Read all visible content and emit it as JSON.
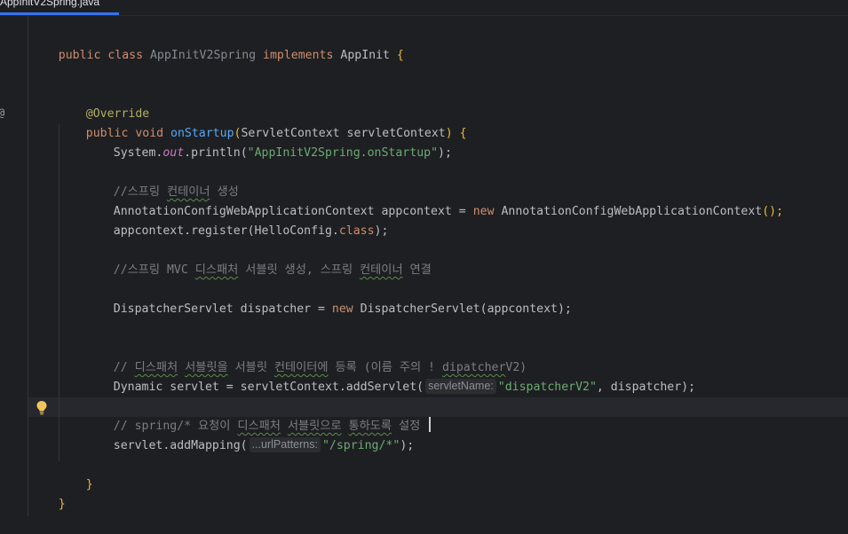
{
  "tab": {
    "label": "AppInitV2Spring.java"
  },
  "code": {
    "l1": {
      "kw1": "public ",
      "kw2": "class ",
      "name": "AppInitV2Spring ",
      "kw3": "implements ",
      "iface": "AppInit ",
      "brace": "{"
    },
    "l2": {
      "ann": "@Override"
    },
    "l3": {
      "kw1": "public ",
      "kw2": "void ",
      "fn": "onStartup",
      "p1": "(",
      "type": "ServletContext servletContext",
      "p2": ") ",
      "brace": "{"
    },
    "l4": {
      "a": "System.",
      "out": "out",
      "b": ".println(",
      "str": "\"AppInitV2Spring.onStartup\"",
      "c": ");"
    },
    "l5": {
      "cmt1": "//스프링 ",
      "typo": "컨테이너",
      "cmt2": " 생성"
    },
    "l6": {
      "a": "AnnotationConfigWebApplicationContext appcontext = ",
      "kw": "new ",
      "b": "AnnotationConfigWebApplicationContext",
      "c": "();"
    },
    "l7": {
      "a": "appcontext.register(HelloConfig.",
      "kw": "class",
      "b": ");"
    },
    "l8": {
      "cmt1": "//스프링 MVC ",
      "typo1": "디스패처",
      "cmt2": " 서블릿 생성, 스프링 ",
      "typo2": "컨테이너",
      "cmt3": " 연결"
    },
    "l9": {
      "a": "DispatcherServlet dispatcher = ",
      "kw": "new ",
      "b": "DispatcherServlet(appcontext);"
    },
    "l10": {
      "cmt1": "// ",
      "typo1": "디스패처",
      "cmt2": " ",
      "typo2": "서블릿을",
      "cmt3": " 서블릿 ",
      "typo3": "컨테이터에",
      "cmt4": " 등록 (이름 주의 ! ",
      "typo4": "dipatcher",
      "cmt5": "V2)"
    },
    "l11": {
      "a": "Dynamic servlet = servletContext.addServlet(",
      "hint": "servletName:",
      "str": "\"dispatcherV2\"",
      "b": ", dispatcher);"
    },
    "l12": {
      "cmt1": "// spring/* 요청이 ",
      "typo1": "디스패처",
      "cmt2": " ",
      "typo2": "서블릿으로",
      "cmt3": " ",
      "typo3": "통하도록",
      "cmt4": " 설정 "
    },
    "l13": {
      "a": "servlet.addMapping(",
      "hint": "...urlPatterns:",
      "str": "\"/spring/*\"",
      "b": ");"
    },
    "l14": {
      "brace": "}"
    },
    "l15": {
      "brace": "}"
    }
  },
  "gutter": {
    "override_marker": "@"
  }
}
